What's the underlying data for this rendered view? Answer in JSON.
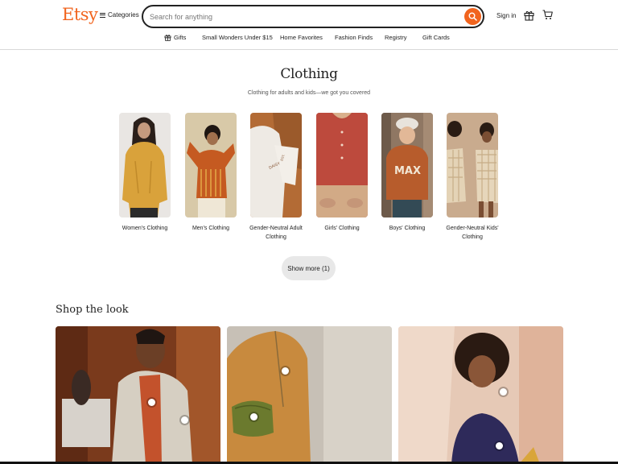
{
  "header": {
    "logo": "Etsy",
    "categories_label": "Categories",
    "search_placeholder": "Search for anything",
    "signin_label": "Sign in"
  },
  "subnav": {
    "items": [
      "Gifts",
      "Small Wonders Under $15",
      "Home Favorites",
      "Fashion Finds",
      "Registry",
      "Gift Cards"
    ]
  },
  "clothing": {
    "title": "Clothing",
    "subtitle": "Clothing for adults and kids—we got you covered",
    "categories": [
      "Women's Clothing",
      "Men's Clothing",
      "Gender-Neutral Adult Clothing",
      "Girls' Clothing",
      "Boys' Clothing",
      "Gender-Neutral Kids' Clothing"
    ],
    "show_more": "Show more (1)"
  },
  "shop_the_look": {
    "title": "Shop the look"
  },
  "colors": {
    "brand": "#F1641E"
  }
}
